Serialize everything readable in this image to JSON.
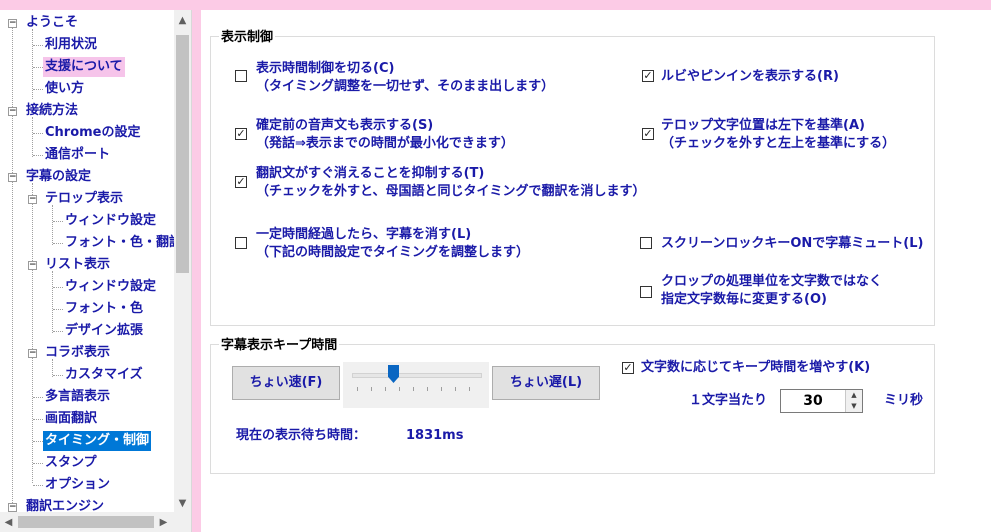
{
  "tree": {
    "items": [
      {
        "label": "ようこそ"
      },
      {
        "label": "利用状況"
      },
      {
        "label": "支援について"
      },
      {
        "label": "使い方"
      },
      {
        "label": "接続方法"
      },
      {
        "label": "Chromeの設定"
      },
      {
        "label": "通信ポート"
      },
      {
        "label": "字幕の設定"
      },
      {
        "label": "テロップ表示"
      },
      {
        "label": "ウィンドウ設定"
      },
      {
        "label": "フォント・色・翻訳"
      },
      {
        "label": "リスト表示"
      },
      {
        "label": "ウィンドウ設定"
      },
      {
        "label": "フォント・色"
      },
      {
        "label": "デザイン拡張"
      },
      {
        "label": "コラボ表示"
      },
      {
        "label": "カスタマイズ"
      },
      {
        "label": "多言語表示"
      },
      {
        "label": "画面翻訳"
      },
      {
        "label": "タイミング・制御"
      },
      {
        "label": "スタンプ"
      },
      {
        "label": "オプション"
      },
      {
        "label": "翻訳エンジン"
      }
    ],
    "selected": "タイミング・制御"
  },
  "display_control": {
    "title": "表示制御",
    "timing_off": {
      "checked": false,
      "line1": "表示時間制御を切る(C)",
      "line2": "（タイミング調整を一切せず、そのまま出します）"
    },
    "show_pending": {
      "checked": true,
      "line1": "確定前の音声文も表示する(S)",
      "line2": "（発話⇒表示までの時間が最小化できます）"
    },
    "suppress_translation": {
      "checked": true,
      "line1": "翻訳文がすぐ消えることを抑制する(T)",
      "line2": "（チェックを外すと、母国語と同じタイミングで翻訳を消します）"
    },
    "clear_after_time": {
      "checked": false,
      "line1": "一定時間経過したら、字幕を消す(L)",
      "line2": "（下記の時間設定でタイミングを調整します）"
    },
    "ruby_pinyin": {
      "checked": true,
      "line1": "ルビやピンインを表示する(R)"
    },
    "telop_position": {
      "checked": true,
      "line1": "テロップ文字位置は左下を基準(A)",
      "line2": "（チェックを外すと左上を基準にする）"
    },
    "screen_lock_mute": {
      "checked": false,
      "line1": "スクリーンロックキーONで字幕ミュート(L)"
    },
    "crop_unit": {
      "checked": false,
      "line1": "クロップの処理単位を文字数ではなく",
      "line2": "指定文字数毎に変更する(O)"
    }
  },
  "keep_time": {
    "title": "字幕表示キープ時間",
    "faster_button": "ちょい速(F)",
    "slower_button": "ちょい遅(L)",
    "slider_level": 0.3,
    "increase_by_chars": {
      "checked": true,
      "label": "文字数に応じてキープ時間を増やす(K)"
    },
    "per_char_label": "１文字当たり",
    "per_char_value": "30",
    "unit": "ミリ秒",
    "wait_label": "現在の表示待ち時間：",
    "wait_value": "1831ms"
  },
  "glyphs": {
    "check": "☑",
    "checkmark": "✓",
    "up": "▲",
    "down": "▼",
    "left": "◀",
    "right": "▶",
    "minus": "−"
  }
}
